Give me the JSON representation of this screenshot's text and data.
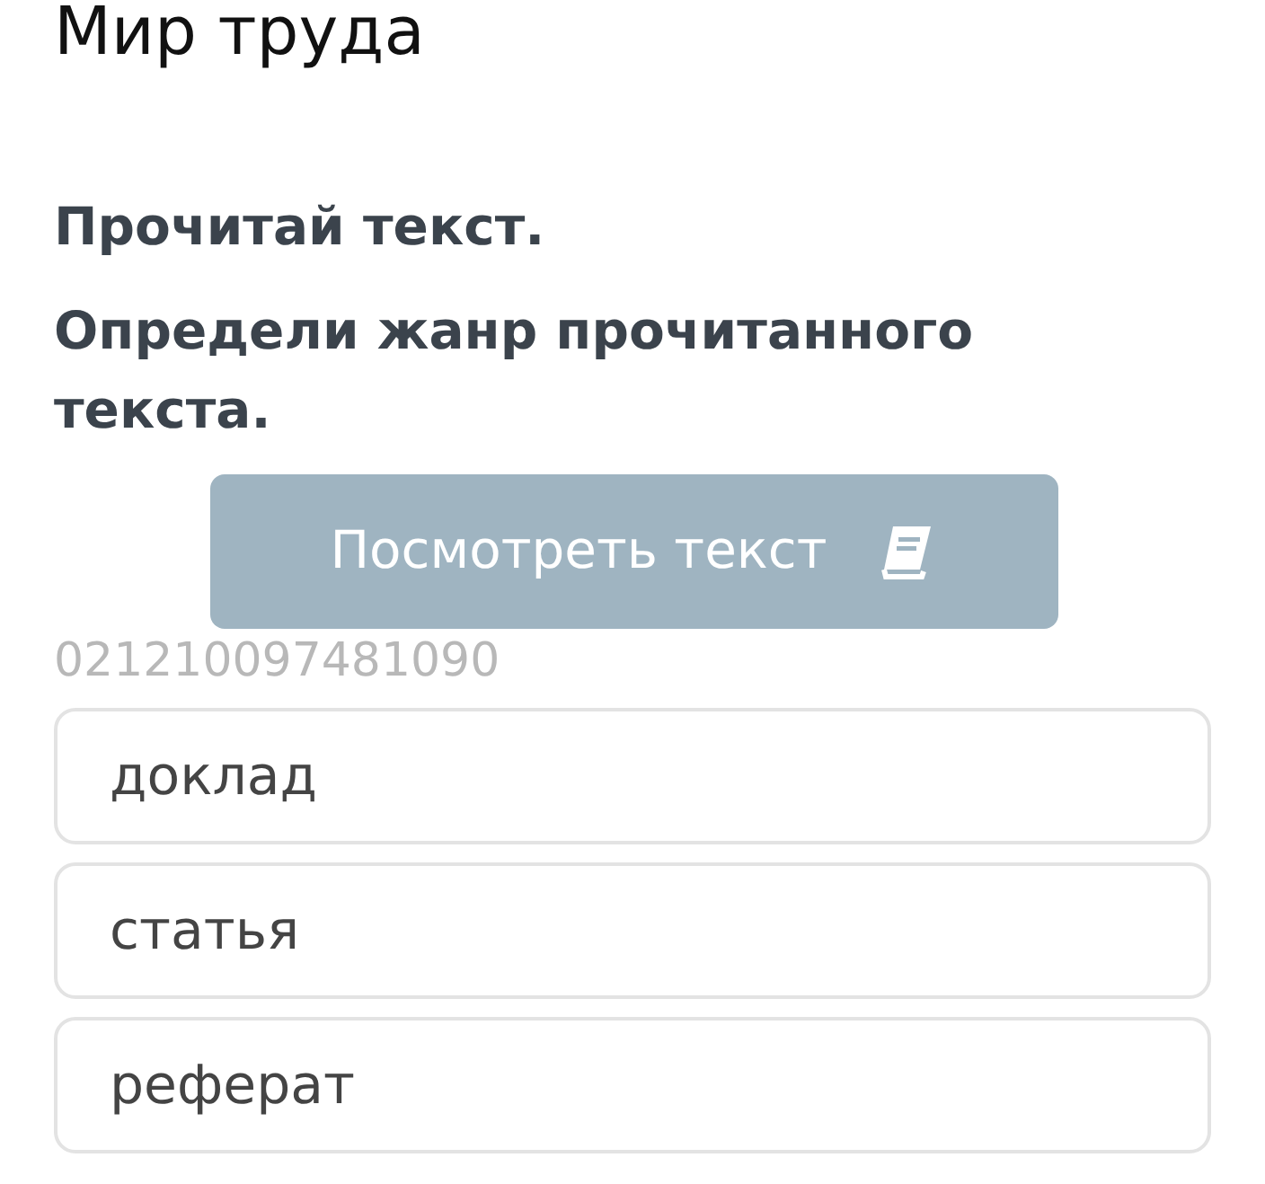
{
  "title": "Мир труда",
  "instructions": [
    "Прочитай текст.",
    "Определи жанр прочитанного текста."
  ],
  "view_button": {
    "label": "Посмотреть текст"
  },
  "question_id": "021210097481090",
  "options": [
    {
      "label": "доклад",
      "selected": false
    },
    {
      "label": "статья",
      "selected": false
    },
    {
      "label": "реферат",
      "selected": false
    }
  ]
}
